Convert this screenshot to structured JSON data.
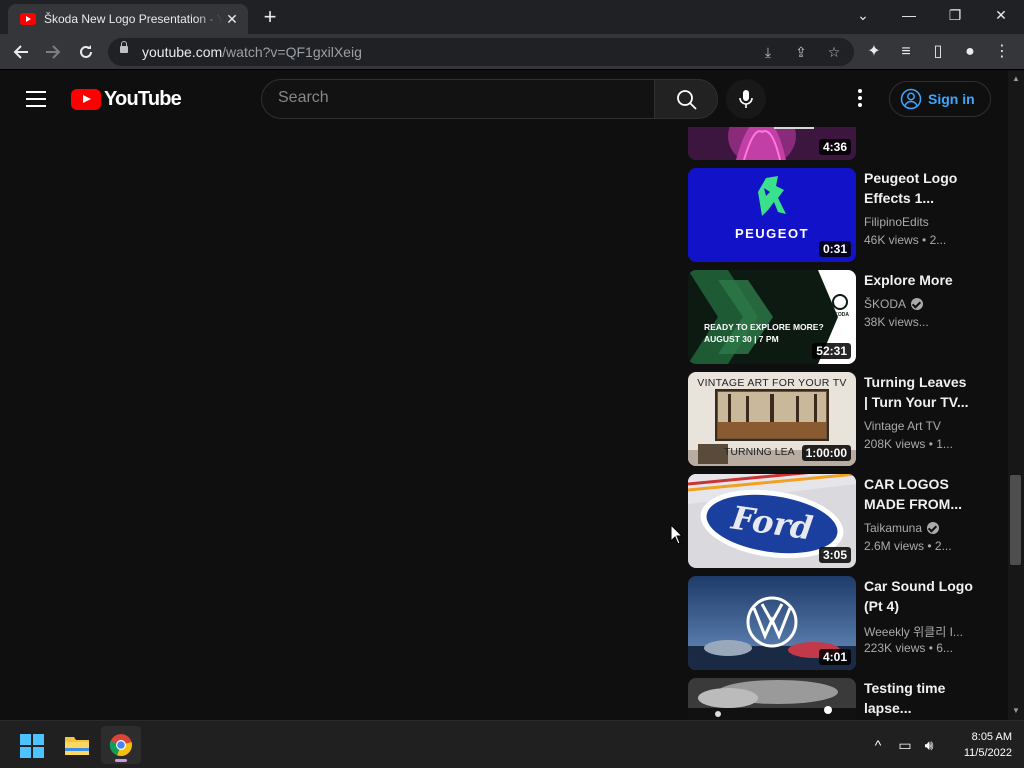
{
  "browser": {
    "tab_title": "Škoda New Logo Presentation - YouTube",
    "url_host": "youtube.com",
    "url_path": "/watch?v=QF1gxilXeig"
  },
  "youtube": {
    "logo_text": "YouTube",
    "search_placeholder": "Search",
    "signin_label": "Sign in"
  },
  "recommendations": [
    {
      "thumb_icon": "purple-figure-thumbnail",
      "title": "",
      "duration": "4:36"
    },
    {
      "thumb_icon": "peugeot-lion-thumbnail",
      "thumb_text": "PEUGEOT",
      "title": "Peugeot Logo Effects 1...",
      "channel": "FilipinoEdits",
      "verified": false,
      "views": "46K views",
      "age": "2..."
    },
    {
      "thumb_icon": "skoda-explore-thumbnail",
      "thumb_text_1": "READY TO EXPLORE MORE?",
      "thumb_text_2": "AUGUST 30 | 7 PM",
      "thumb_brand": "ŠKODA",
      "title": "Explore More",
      "channel": "ŠKODA",
      "verified": true,
      "views": "38K views...",
      "age": ""
    },
    {
      "thumb_icon": "vintage-forest-painting-thumbnail",
      "thumb_text_1": "VINTAGE ART FOR YOUR TV",
      "thumb_text_2": "TURNING LEA",
      "title": "Turning Leaves | Turn Your TV...",
      "channel": "Vintage Art TV",
      "verified": false,
      "views": "208K views",
      "age": "1...",
      "duration": "1:00:00"
    },
    {
      "thumb_icon": "ford-dominoes-thumbnail",
      "thumb_text": "Ford",
      "title": "CAR LOGOS MADE FROM...",
      "channel": "Taikamuna",
      "verified": true,
      "views": "2.6M views",
      "age": "2...",
      "duration": "3:05"
    },
    {
      "thumb_icon": "volkswagen-logo-thumbnail",
      "title": "Car Sound Logo (Pt 4)",
      "channel": "Weeekly 위클리 I...",
      "verified": false,
      "views": "223K views",
      "age": "6...",
      "duration": "4:01"
    },
    {
      "thumb_icon": "time-lapse-thumbnail",
      "title": "Testing time lapse..."
    }
  ],
  "durations": {
    "peugeot": "0:31",
    "skoda": "52:31"
  },
  "taskbar": {
    "time": "8:05 AM",
    "date": "11/5/2022"
  },
  "colors": {
    "youtube_red": "#ff0000",
    "link_blue": "#3ea6ff",
    "background": "#0f0f0f"
  }
}
